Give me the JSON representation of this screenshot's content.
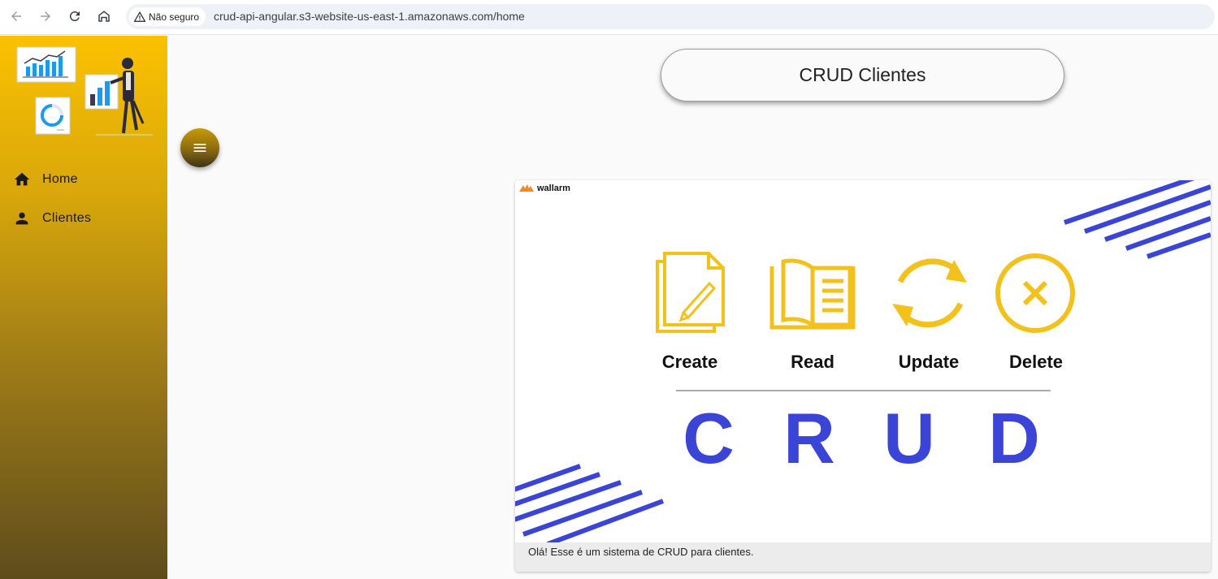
{
  "browser": {
    "security_label": "Não seguro",
    "url": "crud-api-angular.s3-website-us-east-1.amazonaws.com/home"
  },
  "sidebar": {
    "items": [
      {
        "label": "Home",
        "icon": "home-icon"
      },
      {
        "label": "Clientes",
        "icon": "person-icon"
      }
    ]
  },
  "header": {
    "title": "CRUD Clientes"
  },
  "card": {
    "brand": "wallarm",
    "operations": [
      "Create",
      "Read",
      "Update",
      "Delete"
    ],
    "letters": [
      "C",
      "R",
      "U",
      "D"
    ],
    "caption": "Olá! Esse é um sistema de CRUD para clientes."
  },
  "colors": {
    "sidebar_top": "#fbc100",
    "sidebar_bottom": "#5e4c1c",
    "icon_yellow": "#f2c11c",
    "crud_blue": "#3a45d8"
  }
}
